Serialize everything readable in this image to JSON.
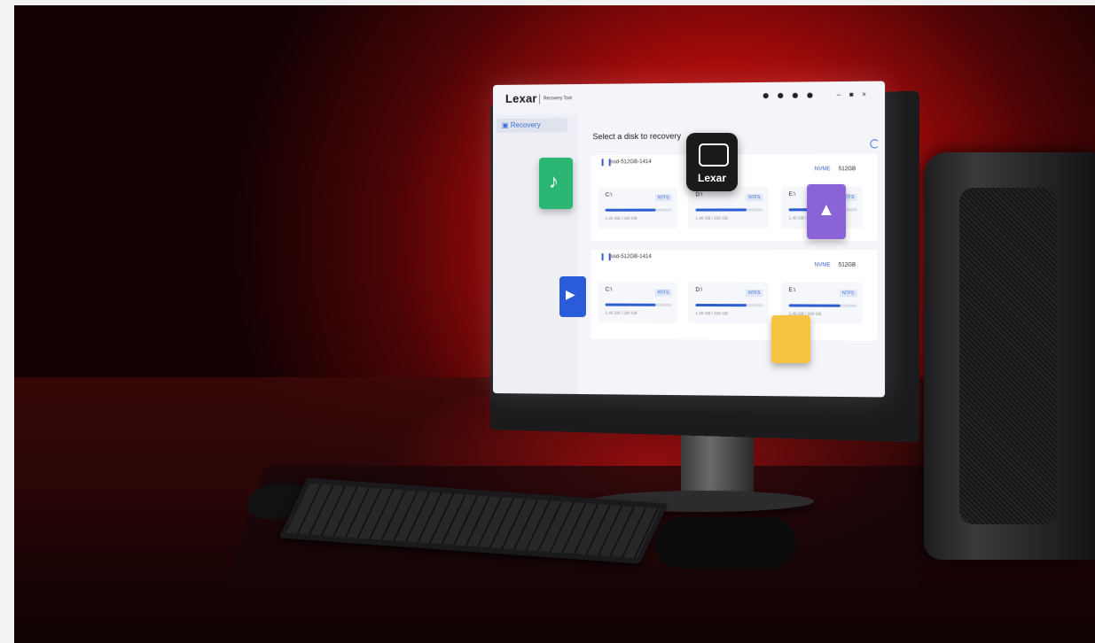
{
  "app": {
    "logo": "Lexar",
    "title": "Recovery Tool",
    "window_controls": [
      "–",
      "■",
      "×"
    ]
  },
  "sidebar": {
    "items": [
      {
        "label": "Recovery",
        "icon": "recovery-icon"
      }
    ]
  },
  "main": {
    "heading": "Select a disk to recovery",
    "disks": [
      {
        "name": "ssd-512GB-1414",
        "type": "NVME",
        "size": "512GB",
        "partitions": [
          {
            "letter": "C:\\",
            "fs": "NTFS",
            "capacity": "1.45 GB / 220 GB",
            "used": 0.75
          },
          {
            "letter": "D:\\",
            "fs": "NTFS",
            "capacity": "1.45 GB / 220 GB",
            "used": 0.75
          },
          {
            "letter": "E:\\",
            "fs": "NTFS",
            "capacity": "1.45 GB / 220 GB",
            "used": 0.75
          }
        ]
      },
      {
        "name": "ssd-512GB-1414",
        "type": "NVME",
        "size": "512GB",
        "partitions": [
          {
            "letter": "C:\\",
            "fs": "NTFS",
            "capacity": "1.45 GB / 220 GB",
            "used": 0.75
          },
          {
            "letter": "D:\\",
            "fs": "NTFS",
            "capacity": "1.45 GB / 220 GB",
            "used": 0.75
          },
          {
            "letter": "E:\\",
            "fs": "NTFS",
            "capacity": "1.45 GB / 220 GB",
            "used": 0.75
          }
        ]
      }
    ]
  },
  "floating_app": {
    "brand": "Lexar"
  },
  "colors": {
    "accent": "#2d5fd0",
    "background_glow": "#d31010"
  }
}
